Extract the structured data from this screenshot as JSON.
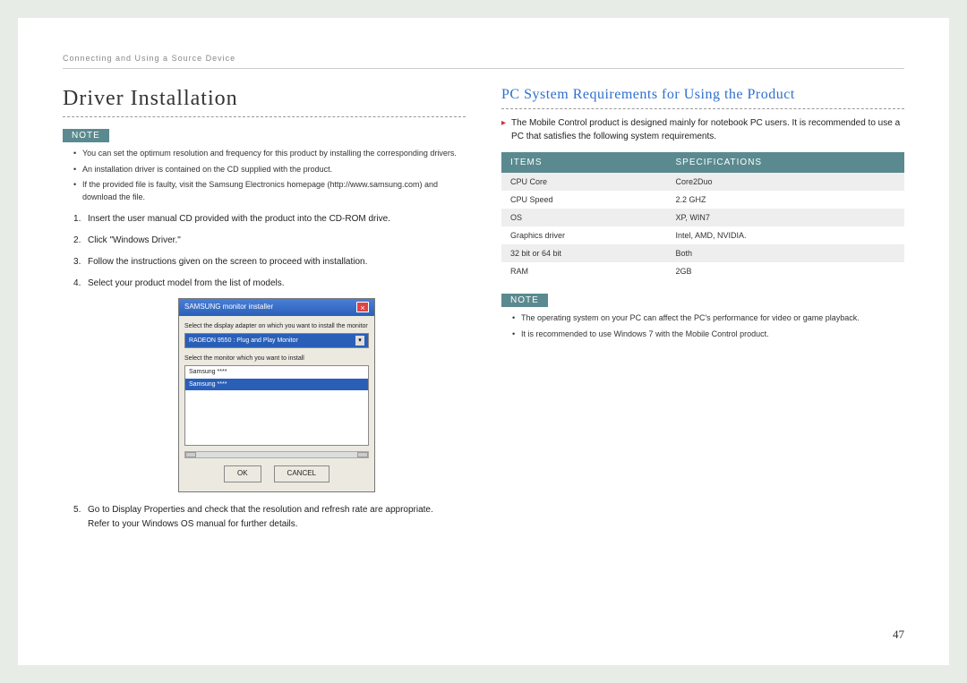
{
  "breadcrumb": "Connecting and Using a Source Device",
  "page_number": "47",
  "left": {
    "heading": "Driver Installation",
    "note_label": "NOTE",
    "note_bullets": [
      "You can set the optimum resolution and frequency for this product by installing the corresponding drivers.",
      "An installation driver is contained on the CD supplied with the product.",
      "If the provided file is faulty, visit the Samsung Electronics homepage (http://www.samsung.com) and download the file."
    ],
    "steps": [
      "Insert the user manual CD provided with the product into the CD-ROM drive.",
      "Click \"Windows Driver.\"",
      "Follow the instructions given on the screen to proceed with installation.",
      "Select your product model from the list of models.",
      "Go to Display Properties and check that the resolution and refresh rate are appropriate."
    ],
    "step5_sub": "Refer to your Windows OS manual for further details.",
    "dialog": {
      "title": "SAMSUNG monitor installer",
      "label_top": "Select the display adapter on which you want to install the monitor",
      "select_value": "RADEON 9550 : Plug and Play Monitor",
      "label_mid": "Select the monitor which you want to install",
      "list_items": [
        "Samsung ****",
        "Samsung ****"
      ],
      "btn_ok": "OK",
      "btn_cancel": "CANCEL"
    }
  },
  "right": {
    "heading": "PC System Requirements for Using the Product",
    "intro": "The Mobile Control product is designed mainly for notebook PC users. It is recommended to use a PC that satisfies the following system requirements.",
    "table": {
      "headers": [
        "ITEMS",
        "SPECIFICATIONS"
      ],
      "rows": [
        [
          "CPU Core",
          "Core2Duo"
        ],
        [
          "CPU Speed",
          "2.2 GHZ"
        ],
        [
          "OS",
          "XP, WIN7"
        ],
        [
          "Graphics driver",
          "Intel, AMD, NVIDIA."
        ],
        [
          "32 bit or 64 bit",
          "Both"
        ],
        [
          "RAM",
          "2GB"
        ]
      ]
    },
    "note_label": "NOTE",
    "note_bullets": [
      "The operating system on your PC can affect the PC's performance for video or game playback.",
      "It is recommended to use Windows 7 with the Mobile Control product."
    ]
  }
}
